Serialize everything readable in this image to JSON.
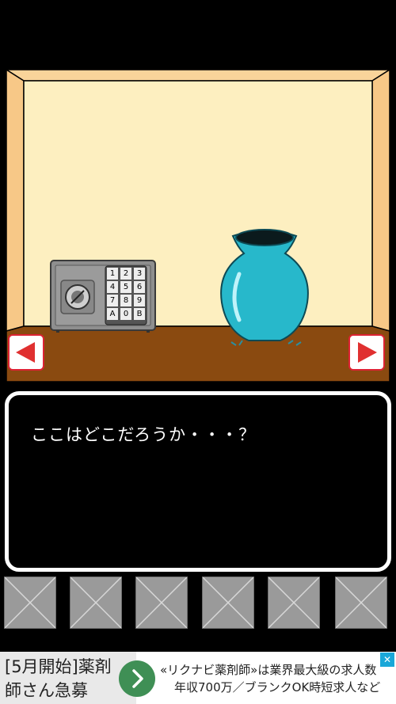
{
  "message": {
    "text": "ここはどこだろうか・・・？"
  },
  "safe": {
    "keypad": [
      "1",
      "2",
      "3",
      "4",
      "5",
      "6",
      "7",
      "8",
      "9",
      "A",
      "0",
      "B"
    ]
  },
  "navigation": {
    "left_icon": "left-arrow-icon",
    "right_icon": "right-arrow-icon"
  },
  "inventory": {
    "slot_count": 6,
    "slot_icon": "empty-slot-icon"
  },
  "ad": {
    "headline_line1": "[5月開始]薬剤",
    "headline_line2": "師さん急募",
    "body_line1": "«リクナビ薬剤師»は業界最大級の求人数",
    "body_line2": "年収700万／ブランクOK時短求人など",
    "arrow_icon": "chevron-right-icon",
    "info_icon": "ad-choices-icon",
    "accent": "#3f8f55"
  },
  "colors": {
    "wall": "#fdefc0",
    "frame": "#f9cf92",
    "floor": "#8a4a10",
    "vase": "#27b8cb",
    "nav_arrow": "#e03030"
  }
}
